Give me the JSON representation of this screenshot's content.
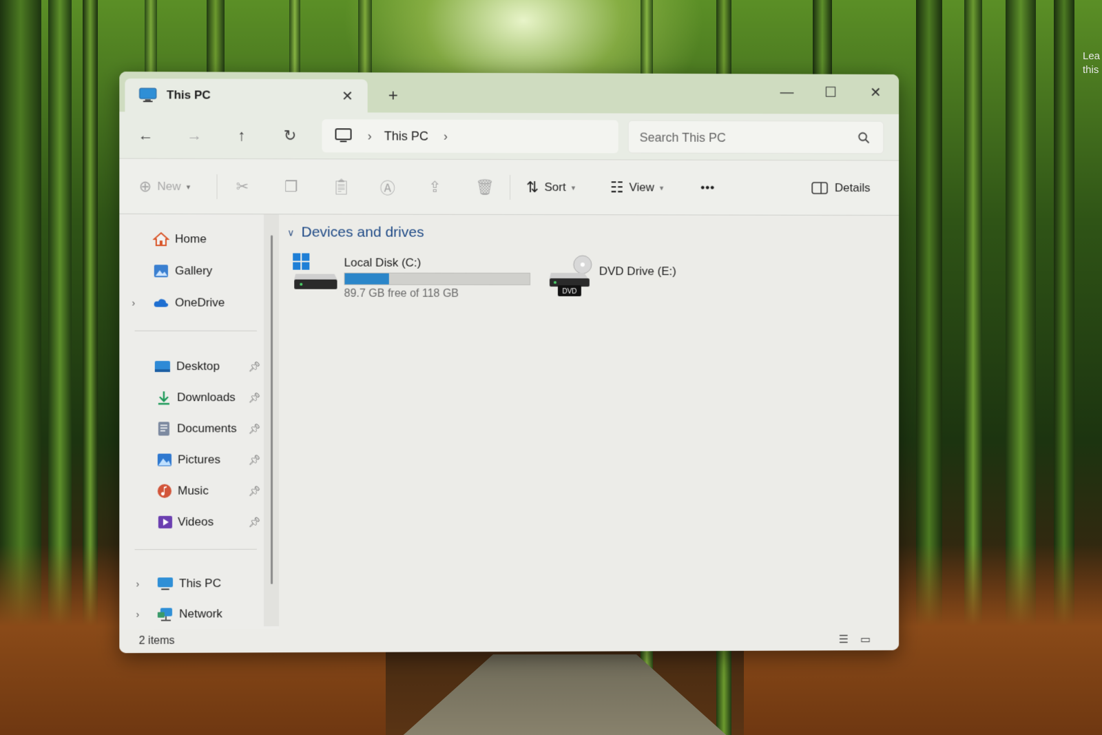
{
  "desktop": {
    "corner_text": [
      "Lea",
      "this"
    ]
  },
  "window": {
    "tab": {
      "title": "This PC",
      "icon": "monitor-icon"
    },
    "controls": {
      "minimize": "—",
      "maximize": "☐",
      "close": "✕"
    },
    "new_tab_label": "+"
  },
  "nav": {
    "back": "←",
    "forward": "→",
    "up": "↑",
    "refresh": "↻",
    "breadcrumb": [
      "This PC"
    ],
    "search_placeholder": "Search This PC"
  },
  "toolbar": {
    "new_label": "New",
    "sort_label": "Sort",
    "view_label": "View",
    "more_label": "•••",
    "details_label": "Details"
  },
  "sidebar": {
    "top": [
      {
        "label": "Home",
        "icon": "home-icon",
        "expandable": false
      },
      {
        "label": "Gallery",
        "icon": "gallery-icon",
        "expandable": false
      },
      {
        "label": "OneDrive",
        "icon": "cloud-icon",
        "expandable": true
      }
    ],
    "quick_access": [
      {
        "label": "Desktop",
        "icon": "desktop-folder-icon",
        "pinned": true
      },
      {
        "label": "Downloads",
        "icon": "download-icon",
        "pinned": true
      },
      {
        "label": "Documents",
        "icon": "documents-icon",
        "pinned": true
      },
      {
        "label": "Pictures",
        "icon": "pictures-icon",
        "pinned": true
      },
      {
        "label": "Music",
        "icon": "music-icon",
        "pinned": true
      },
      {
        "label": "Videos",
        "icon": "videos-icon",
        "pinned": true
      }
    ],
    "bottom": [
      {
        "label": "This PC",
        "icon": "monitor-icon",
        "expandable": true
      },
      {
        "label": "Network",
        "icon": "network-icon",
        "expandable": true
      }
    ]
  },
  "content": {
    "group_title": "Devices and drives",
    "drives": [
      {
        "name": "Local Disk (C:)",
        "free_text": "89.7 GB free of 118 GB",
        "used_fraction": 0.24,
        "icon": "windows-drive-icon"
      },
      {
        "name": "DVD Drive (E:)",
        "icon": "dvd-drive-icon",
        "badge": "DVD"
      }
    ]
  },
  "status": {
    "item_count": "2 items"
  },
  "colors": {
    "accent": "#2b86c9",
    "group_title": "#1f4a86",
    "titlebar": "#cfdcc0"
  }
}
